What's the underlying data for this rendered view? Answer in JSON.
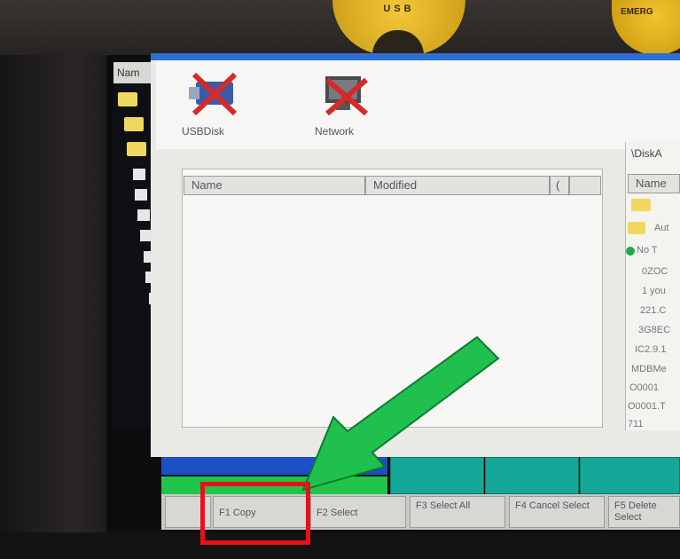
{
  "hardware": {
    "usb_cap_label": "USB",
    "emergency_label": "EMERG"
  },
  "tree": {
    "header": "Nam"
  },
  "devices": [
    {
      "name": "USBDisk",
      "icon": "usb-disk-icon"
    },
    {
      "name": "Network",
      "icon": "network-icon"
    }
  ],
  "file_list": {
    "columns": [
      "Name",
      "Modified",
      "(",
      ""
    ]
  },
  "right_panel": {
    "path": "\\DiskA",
    "column": "Name",
    "items": [
      "",
      "Aut",
      "No T",
      "0ZOC",
      "1 you",
      "221.C",
      "3G8EC",
      "IC2.9.1",
      "MDBMe",
      "O0001",
      "O0001.T",
      "711"
    ]
  },
  "function_keys": [
    {
      "key": "F1",
      "label": "F1 Copy"
    },
    {
      "key": "F2",
      "label": "F2 Select"
    },
    {
      "key": "F3",
      "label": "F3 Select All"
    },
    {
      "key": "F4",
      "label": "F4 Cancel Select"
    },
    {
      "key": "F5",
      "label": "F5 Delete Select"
    }
  ],
  "colors": {
    "title_bar": "#2d6fd3",
    "status_blue": "#1d4fc7",
    "status_green": "#21c44a",
    "annotation_arrow": "#20c04f",
    "annotation_box": "#e8101a"
  }
}
